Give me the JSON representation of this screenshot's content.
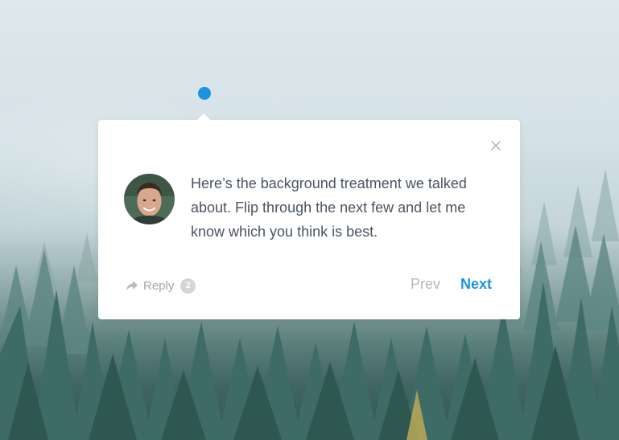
{
  "hotspot": {
    "color": "#1d93e0"
  },
  "comment": {
    "message": "Here’s the background treatment we talked about. Flip through the next few and let me know which you think is best.",
    "avatar_icon": "user-avatar"
  },
  "actions": {
    "reply_label": "Reply",
    "reply_count": "2",
    "reply_icon": "reply-arrow-icon",
    "prev_label": "Prev",
    "next_label": "Next",
    "close_icon": "close-icon"
  },
  "colors": {
    "accent": "#1d93e0",
    "text": "#4a5460",
    "muted": "#a0a6ab"
  }
}
